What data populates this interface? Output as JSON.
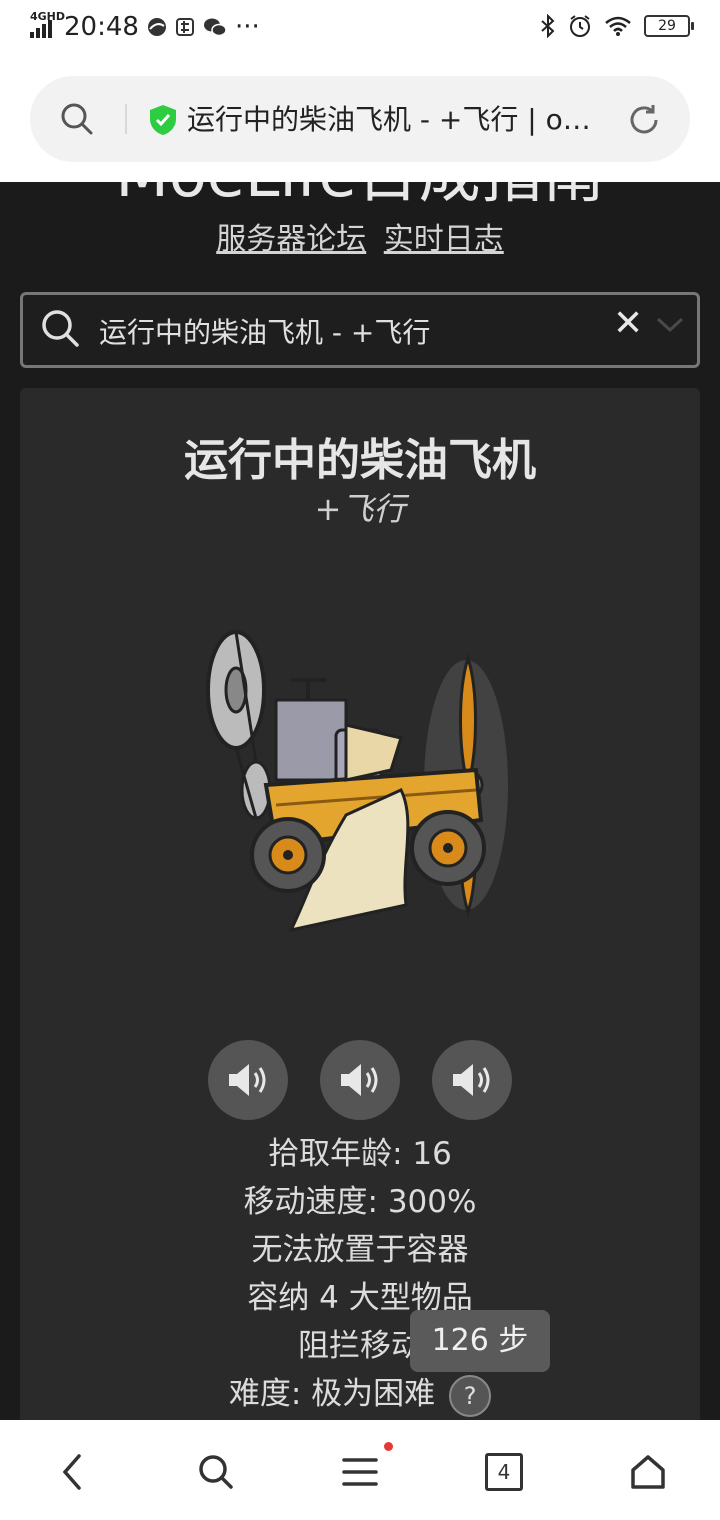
{
  "status_bar": {
    "network": "4GHD",
    "time": "20:48",
    "battery": "29"
  },
  "browser": {
    "url_text": "运行中的柴油飞机 - +飞行 | o…"
  },
  "site": {
    "title": "MoeLife日成指南",
    "links": [
      "服务器论坛",
      "实时日志"
    ]
  },
  "search": {
    "query": "运行中的柴油飞机 - +飞行",
    "clear_label": "✕"
  },
  "item": {
    "name": "运行中的柴油飞机",
    "subtitle": "+飞行",
    "stats": [
      "拾取年龄: 16",
      "移动速度: 300%",
      "无法放置于容器",
      "容纳 4 大型物品",
      "阻拦移动",
      "难度: 极为困难"
    ],
    "help_label": "?"
  },
  "toast": "126 步",
  "bottom_nav": {
    "tab_count": "4"
  },
  "colors": {
    "page_bg": "#1b1b1b",
    "card_bg": "#2a2a2a",
    "secure_green": "#2ecc40",
    "notification_red": "#e53935"
  }
}
